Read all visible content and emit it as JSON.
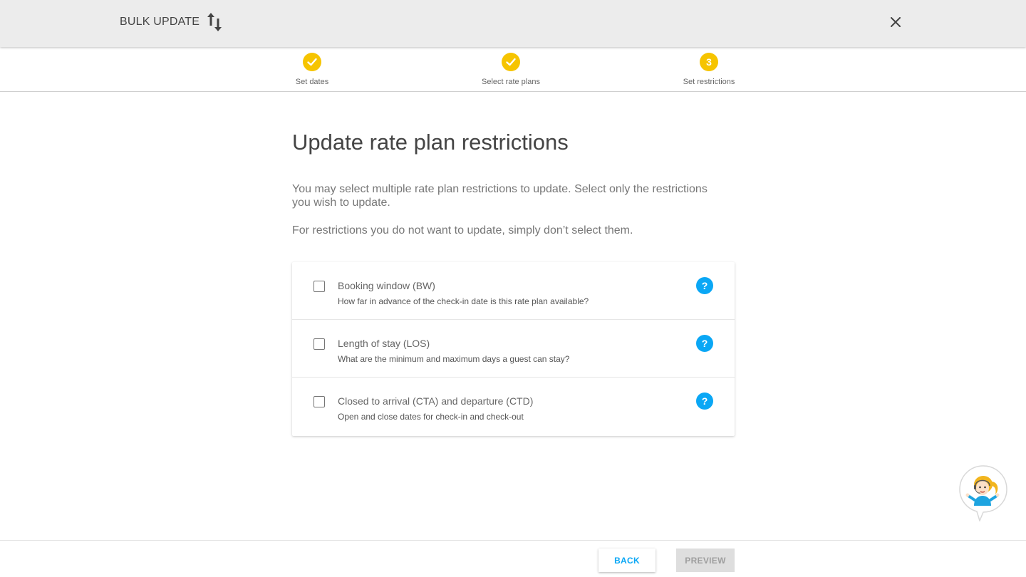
{
  "header": {
    "title": "BULK UPDATE",
    "icon": "sort-arrows-icon",
    "close_icon": "close-icon"
  },
  "stepper": {
    "steps": [
      {
        "label": "Set dates",
        "state": "complete",
        "marker": ""
      },
      {
        "label": "Select rate plans",
        "state": "complete",
        "marker": ""
      },
      {
        "label": "Set restrictions",
        "state": "current",
        "marker": "3"
      }
    ],
    "accent_color": "#f6c400"
  },
  "main": {
    "title": "Update rate plan restrictions",
    "description_1": "You may select multiple rate plan restrictions to update. Select only the restrictions you wish to update.",
    "description_2": "For restrictions you do not want to update, simply don’t select them."
  },
  "restrictions": [
    {
      "title": "Booking window (BW)",
      "subtitle": "How far in advance of the check-in date is this rate plan available?",
      "checked": false,
      "help": "?"
    },
    {
      "title": "Length of stay (LOS)",
      "subtitle": "What are the minimum and maximum days a guest can stay?",
      "checked": false,
      "help": "?"
    },
    {
      "title": "Closed to arrival (CTA) and departure (CTD)",
      "subtitle": "Open and close dates for check-in and check-out",
      "checked": false,
      "help": "?"
    }
  ],
  "footer": {
    "back_label": "BACK",
    "preview_label": "PREVIEW",
    "preview_enabled": false
  },
  "colors": {
    "help_blue": "#0aa7f5",
    "topbar_bg": "#ececec"
  }
}
